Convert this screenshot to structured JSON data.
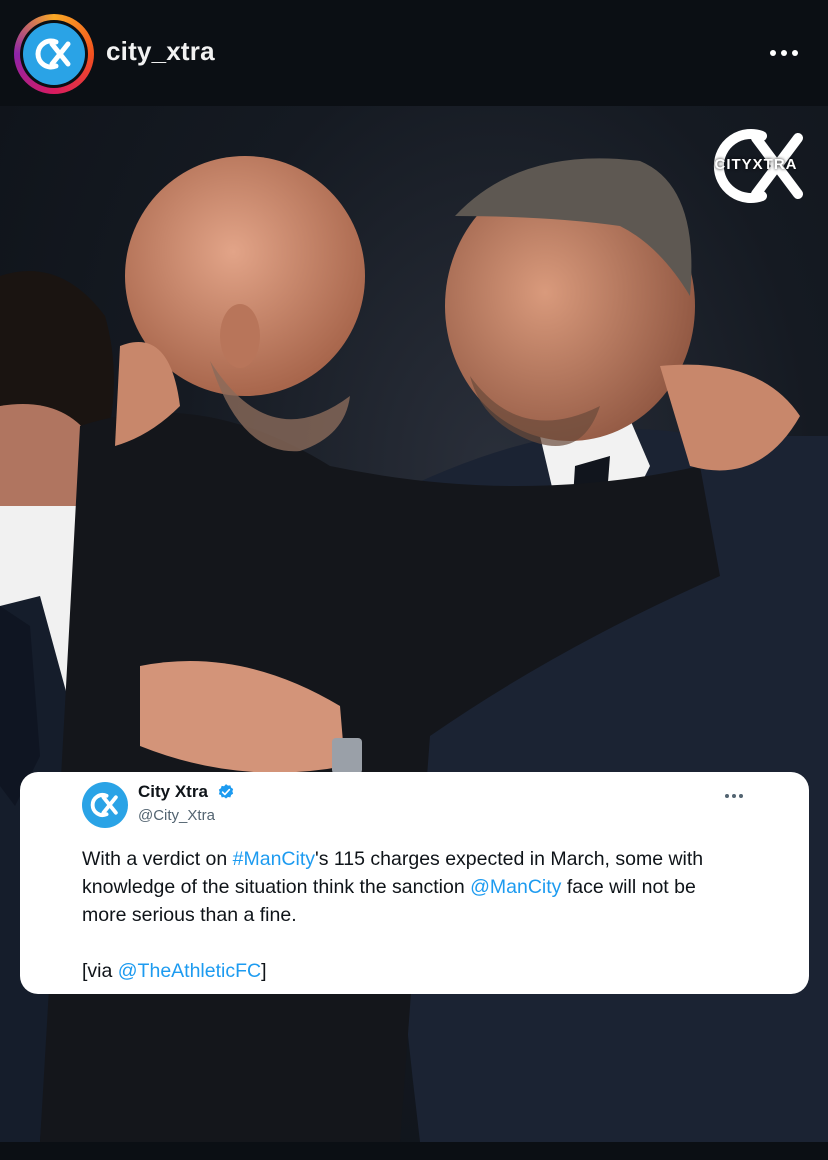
{
  "post": {
    "username": "city_xtra",
    "avatar_icon": "city-xtra-logo-icon",
    "more_icon": "more-horizontal-icon"
  },
  "photo": {
    "watermark_top": "CX",
    "watermark_text": "CITYXTRA"
  },
  "tweet": {
    "display_name": "City Xtra",
    "verified": true,
    "handle": "@City_Xtra",
    "line1_pre": "With a verdict on ",
    "hashtag": "#ManCity",
    "line1_post": "'s 115 charges expected in March, some with",
    "line2_pre": "knowledge of the situation think the sanction ",
    "mention": "@ManCity",
    "line2_post": " face will not be",
    "line3": "more serious than a fine.",
    "via_pre": "[via ",
    "via_mention": "@TheAthleticFC",
    "via_post": "]"
  },
  "colors": {
    "link": "#1d9bf0",
    "brand_blue": "#2aa3e6",
    "verified_blue": "#1d9bf0"
  }
}
